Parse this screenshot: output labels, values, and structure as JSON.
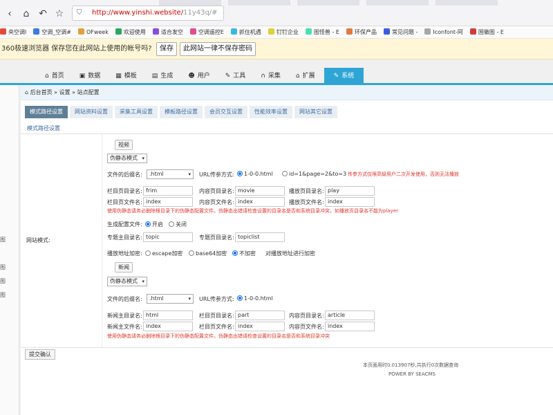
{
  "browser": {
    "url_main": "http://www.yinshi.website/",
    "url_rest": "11y43q/#",
    "bookmarks": [
      "央空调l",
      "空调_空调#",
      "OFweek",
      "欢迎使用",
      "适合发空",
      "空调遥控E",
      "抓住机遇",
      "钉钉企业",
      "图怪兽 - E",
      "环保产品",
      "常见问题 -",
      "Iconfont-阿",
      "国徽图 - E"
    ],
    "savebar_text": "360极速浏览器 保存您在此网站上使用的帐号吗?",
    "save_btn": "保存",
    "never_btn": "此网站一律不保存密码"
  },
  "nav": {
    "tabs": [
      {
        "label": "首页",
        "icon": "⌂"
      },
      {
        "label": "数据",
        "icon": "▣"
      },
      {
        "label": "模板",
        "icon": "▦"
      },
      {
        "label": "生成",
        "icon": "▤"
      },
      {
        "label": "用户",
        "icon": "☻"
      },
      {
        "label": "工具",
        "icon": "✎"
      },
      {
        "label": "采集",
        "icon": "∩"
      },
      {
        "label": "扩展",
        "icon": "⌂"
      },
      {
        "label": "系统",
        "icon": "✎"
      }
    ]
  },
  "breadcrumb": "后台首页 » 设置 » 站点配置",
  "sub_tabs": [
    "模式路径设置",
    "网站资料设置",
    "采集工具设置",
    "模板路径设置",
    "会员交互设置",
    "性能效率设置",
    "网站其它设置"
  ],
  "section_caption": "模式路径设置",
  "row_label": "网站模式:",
  "video": {
    "header": "视频",
    "mode_select": "伪静态模式",
    "ext_label": "文件的后缀名:",
    "ext_value": ".html",
    "url_label": "URL传参方式:",
    "url_opt1": "1-0-0.html",
    "url_opt2": "id=1&page=2&to=3",
    "url_warn": "传参方式仅限高级用户二次开发使用，否则无法播放",
    "f1_label": "栏目页目录名:",
    "f1_value": "frim",
    "f2_label": "内容页目录名:",
    "f2_value": "movie",
    "f3_label": "播放页目录名:",
    "f3_value": "play",
    "f4_label": "栏目页文件名:",
    "f4_value": "index",
    "f5_label": "内容页文件名:",
    "f5_value": "index",
    "f6_label": "播放页文件名:",
    "f6_value": "index",
    "warn": "使用伪静态请务必删除根目录下的伪静态配置文件。伪静态出错请检查设置的目录名是否和系统目录冲突，如播放页目录名不能为player",
    "gen_label": "生成配置文件:",
    "gen_on": "开启",
    "gen_off": "关闭",
    "topic1_label": "专题主目录名:",
    "topic1_value": "topic",
    "topic2_label": "专题页目录名:",
    "topic2_value": "topiclist",
    "enc_label": "播放地址加密:",
    "enc_opt1": "escape加密",
    "enc_opt2": "base64加密",
    "enc_opt3": "不加密",
    "enc_note": "对播放地址进行加密"
  },
  "news": {
    "header": "新闻",
    "mode_select": "伪静态模式",
    "ext_label": "文件的后缀名:",
    "ext_value": ".html",
    "url_label": "URL传参方式:",
    "url_opt1": "1-0-0.html",
    "f1_label": "新闻主目录名:",
    "f1_value": "html",
    "f2_label": "栏目页目录名:",
    "f2_value": "part",
    "f3_label": "内容页目录名:",
    "f3_value": "article",
    "f4_label": "新闻主文件名:",
    "f4_value": "index",
    "f5_label": "栏目页文件名:",
    "f5_value": "index",
    "f6_label": "内容页文件名:",
    "f6_value": "index",
    "warn": "使用伪静态请务必删除根目录下的伪静态配置文件。伪静态出错请检查设置的目录名是否和系统目录冲突"
  },
  "submit_label": "提交确认",
  "footer_line1": "本页面用时0.013907秒,共执行0次数据查询",
  "footer_line2": "POWER BY SEACMS",
  "colors": {
    "accent": "#2fa5d6",
    "warning": "#e0352b",
    "link": "#3c6aa1"
  }
}
